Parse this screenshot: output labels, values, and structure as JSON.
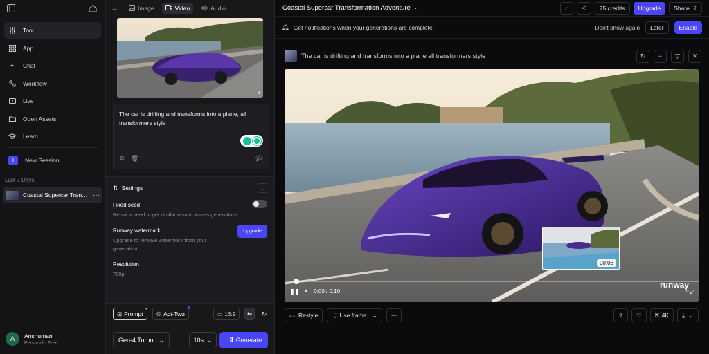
{
  "sidebar": {
    "items": [
      {
        "label": "Tool",
        "icon": "sliders-icon",
        "active": true
      },
      {
        "label": "App",
        "icon": "grid-icon"
      },
      {
        "label": "Chat",
        "icon": "sparkle-icon"
      },
      {
        "label": "Workflow",
        "icon": "workflow-icon"
      },
      {
        "label": "Live",
        "icon": "live-icon"
      },
      {
        "label": "Open Assets",
        "icon": "folder-icon"
      },
      {
        "label": "Learn",
        "icon": "graduation-cap-icon"
      }
    ],
    "new_session": "New Session",
    "section": "Last 7 Days",
    "session": "Coastal Supercar Transformation Adventure",
    "user": {
      "initial": "A",
      "name": "Anshuman",
      "plan": "Personal · Free"
    }
  },
  "panel": {
    "tabs": [
      "Image",
      "Video",
      "Audio"
    ],
    "active_tab": "Video",
    "prompt": "The car is drifting and transforms into a plane, all transformers style",
    "settings": {
      "title": "Settings",
      "fixed_seed": {
        "title": "Fixed seed",
        "desc": "Reuse a seed to get similar results across generations."
      },
      "watermark": {
        "title": "Runway watermark",
        "desc": "Upgrade to remove watermark from your generation.",
        "button": "Upgrade"
      },
      "resolution": {
        "title": "Resolution",
        "value": "720p"
      }
    },
    "modes": {
      "prompt": "Prompt",
      "act_two": "Act-Two",
      "ratio": "16:9"
    },
    "model": "Gen-4 Turbo",
    "duration": "10s",
    "generate": "Generate"
  },
  "main": {
    "title": "Coastal Supercar Transformation Adventure",
    "credits": "75 credits",
    "upgrade": "Upgrade",
    "share": "Share",
    "notification": {
      "text": "Get notifications when your generations are complete.",
      "dismiss": "Don't show again",
      "later": "Later",
      "enable": "Enable"
    },
    "generation_prompt": "The car is drifting and transforms into a plane all transformers style",
    "player": {
      "time": "0:00 / 0:10",
      "pip_time": "00:06",
      "brand": "runway",
      "brand_sub": "fx"
    },
    "actions": {
      "restyle": "Restyle",
      "use_frame": "Use frame",
      "resolution": "4K"
    }
  },
  "colors": {
    "accent": "#4a45f5",
    "car": "#4b2a8e",
    "background": "#0b0b0d"
  }
}
